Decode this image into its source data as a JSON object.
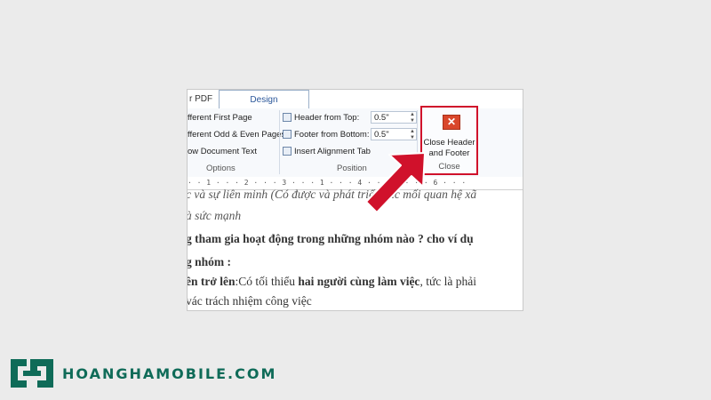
{
  "ribbon": {
    "tabs": {
      "pdf": "r PDF",
      "design": "Design"
    },
    "options": {
      "items": [
        "fferent First Page",
        "fferent Odd & Even Pages",
        "ow Document Text"
      ],
      "label": "Options"
    },
    "position": {
      "header_label": "Header from Top:",
      "header_value": "0.5\"",
      "footer_label": "Footer from Bottom:",
      "footer_value": "0.5\"",
      "insert_tab": "Insert Alignment Tab",
      "label": "Position"
    },
    "close": {
      "button_line1": "Close Header",
      "button_line2": "and Footer",
      "label": "Close"
    }
  },
  "ruler": "· · 1 · · · 2 · · · 3 · · · 1 · · · 4 · · · 5 · · · 6 · · ·",
  "document": {
    "line1": "c và sự liên minh (Có được và phát triển các mối quan hệ xã",
    "line2": "à sức mạnh",
    "line3": "g tham gia hoạt động trong những nhóm nào ? cho ví dụ",
    "line4": "g nhóm :",
    "line5a": "ên trở lên",
    "line5b": ":Có tối thiểu ",
    "line5c": "hai người cùng làm việc",
    "line5d": ", tức là phải",
    "line6": "vác trách nhiệm công việc"
  },
  "brand": {
    "name": "HOANGHAMOBILE.COM",
    "color": "#0f6b58"
  },
  "accent": {
    "highlight": "#d0112b"
  }
}
